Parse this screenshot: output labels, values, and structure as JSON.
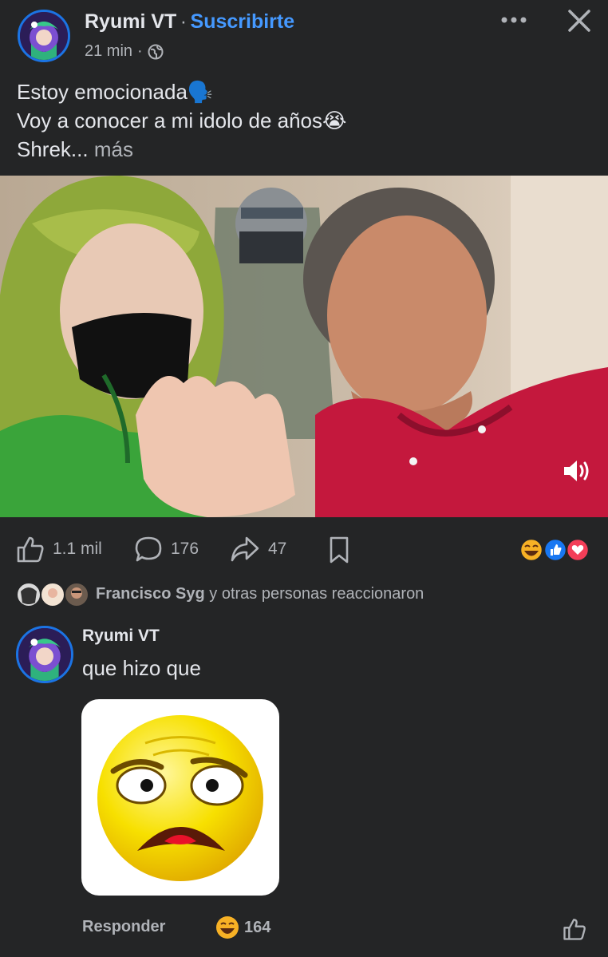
{
  "post": {
    "author": "Ryumi VT",
    "separator": "·",
    "subscribe_label": "Suscribirte",
    "time": "21 min",
    "time_separator": "·",
    "text_line1": "Estoy emocionada🗣️",
    "text_line2": "Voy a conocer a mi idolo de años😭",
    "text_line3": "Shrek...",
    "more_label": "más"
  },
  "actions": {
    "likes": "1.1 mil",
    "comments": "176",
    "shares": "47"
  },
  "reactions_summary": {
    "name": "Francisco Syg",
    "rest": " y otras personas reaccionaron"
  },
  "comment": {
    "author": "Ryumi VT",
    "text": "que hizo que",
    "reply_label": "Responder",
    "reaction_count": "164"
  },
  "icons": {
    "more": "more-options-icon",
    "close": "close-icon",
    "globe": "globe-icon",
    "like": "thumbs-up-icon",
    "comment": "comment-icon",
    "share": "share-icon",
    "save": "bookmark-icon",
    "volume": "volume-icon"
  },
  "colors": {
    "background": "#242526",
    "accent": "#4599ff",
    "secondary_text": "#b0b3b8"
  }
}
